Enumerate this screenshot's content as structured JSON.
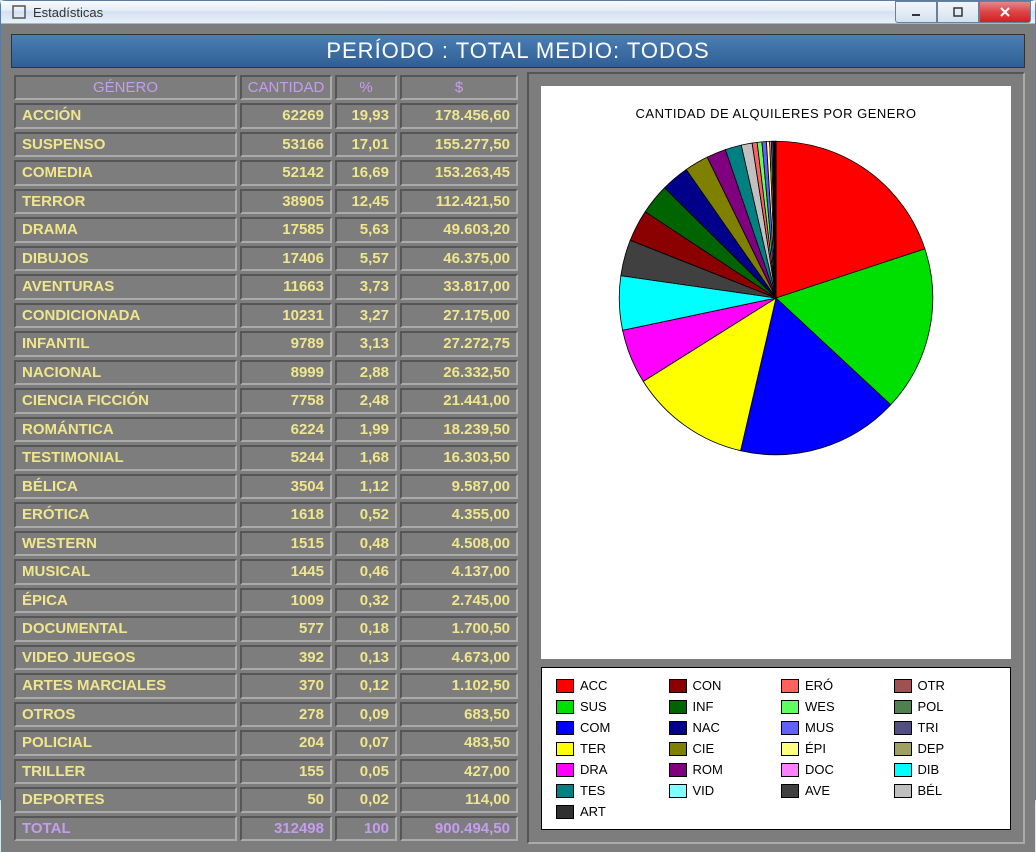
{
  "window": {
    "title": "Estadísticas"
  },
  "period_bar": "PERÍODO : TOTAL  MEDIO: TODOS",
  "table": {
    "headers": {
      "genero": "GÉNERO",
      "cantidad": "CANTIDAD",
      "pct": "%",
      "money": "$"
    },
    "rows": [
      {
        "genero": "ACCIÓN",
        "cantidad": "62269",
        "pct": "19,93",
        "money": "178.456,60"
      },
      {
        "genero": "SUSPENSO",
        "cantidad": "53166",
        "pct": "17,01",
        "money": "155.277,50"
      },
      {
        "genero": "COMEDIA",
        "cantidad": "52142",
        "pct": "16,69",
        "money": "153.263,45"
      },
      {
        "genero": "TERROR",
        "cantidad": "38905",
        "pct": "12,45",
        "money": "112.421,50"
      },
      {
        "genero": "DRAMA",
        "cantidad": "17585",
        "pct": "5,63",
        "money": "49.603,20"
      },
      {
        "genero": "DIBUJOS",
        "cantidad": "17406",
        "pct": "5,57",
        "money": "46.375,00"
      },
      {
        "genero": "AVENTURAS",
        "cantidad": "11663",
        "pct": "3,73",
        "money": "33.817,00"
      },
      {
        "genero": "CONDICIONADA",
        "cantidad": "10231",
        "pct": "3,27",
        "money": "27.175,00"
      },
      {
        "genero": "INFANTIL",
        "cantidad": "9789",
        "pct": "3,13",
        "money": "27.272,75"
      },
      {
        "genero": "NACIONAL",
        "cantidad": "8999",
        "pct": "2,88",
        "money": "26.332,50"
      },
      {
        "genero": "CIENCIA FICCIÓN",
        "cantidad": "7758",
        "pct": "2,48",
        "money": "21.441,00"
      },
      {
        "genero": "ROMÁNTICA",
        "cantidad": "6224",
        "pct": "1,99",
        "money": "18.239,50"
      },
      {
        "genero": "TESTIMONIAL",
        "cantidad": "5244",
        "pct": "1,68",
        "money": "16.303,50"
      },
      {
        "genero": "BÉLICA",
        "cantidad": "3504",
        "pct": "1,12",
        "money": "9.587,00"
      },
      {
        "genero": "ERÓTICA",
        "cantidad": "1618",
        "pct": "0,52",
        "money": "4.355,00"
      },
      {
        "genero": "WESTERN",
        "cantidad": "1515",
        "pct": "0,48",
        "money": "4.508,00"
      },
      {
        "genero": "MUSICAL",
        "cantidad": "1445",
        "pct": "0,46",
        "money": "4.137,00"
      },
      {
        "genero": "ÉPICA",
        "cantidad": "1009",
        "pct": "0,32",
        "money": "2.745,00"
      },
      {
        "genero": "DOCUMENTAL",
        "cantidad": "577",
        "pct": "0,18",
        "money": "1.700,50"
      },
      {
        "genero": "VIDEO JUEGOS",
        "cantidad": "392",
        "pct": "0,13",
        "money": "4.673,00"
      },
      {
        "genero": "ARTES MARCIALES",
        "cantidad": "370",
        "pct": "0,12",
        "money": "1.102,50"
      },
      {
        "genero": "OTROS",
        "cantidad": "278",
        "pct": "0,09",
        "money": "683,50"
      },
      {
        "genero": "POLICIAL",
        "cantidad": "204",
        "pct": "0,07",
        "money": "483,50"
      },
      {
        "genero": "TRILLER",
        "cantidad": "155",
        "pct": "0,05",
        "money": "427,00"
      },
      {
        "genero": "DEPORTES",
        "cantidad": "50",
        "pct": "0,02",
        "money": "114,00"
      }
    ],
    "total": {
      "genero": "TOTAL",
      "cantidad": "312498",
      "pct": "100",
      "money": "900.494,50"
    }
  },
  "chart_data": {
    "type": "pie",
    "title": "CANTIDAD DE ALQUILERES POR GENERO",
    "series": [
      {
        "name": "ACC",
        "value": 62269,
        "color": "#ff0000"
      },
      {
        "name": "SUS",
        "value": 53166,
        "color": "#00e000"
      },
      {
        "name": "COM",
        "value": 52142,
        "color": "#0000ff"
      },
      {
        "name": "TER",
        "value": 38905,
        "color": "#ffff00"
      },
      {
        "name": "DRA",
        "value": 17585,
        "color": "#ff00ff"
      },
      {
        "name": "DIB",
        "value": 17406,
        "color": "#00ffff"
      },
      {
        "name": "AVE",
        "value": 11663,
        "color": "#404040"
      },
      {
        "name": "CON",
        "value": 10231,
        "color": "#8b0000"
      },
      {
        "name": "INF",
        "value": 9789,
        "color": "#006400"
      },
      {
        "name": "NAC",
        "value": 8999,
        "color": "#00008b"
      },
      {
        "name": "CIE",
        "value": 7758,
        "color": "#808000"
      },
      {
        "name": "ROM",
        "value": 6224,
        "color": "#800080"
      },
      {
        "name": "TES",
        "value": 5244,
        "color": "#008080"
      },
      {
        "name": "BÉL",
        "value": 3504,
        "color": "#c0c0c0"
      },
      {
        "name": "ERÓ",
        "value": 1618,
        "color": "#ff6060"
      },
      {
        "name": "WES",
        "value": 1515,
        "color": "#60ff60"
      },
      {
        "name": "MUS",
        "value": 1445,
        "color": "#6060ff"
      },
      {
        "name": "ÉPI",
        "value": 1009,
        "color": "#ffff80"
      },
      {
        "name": "DOC",
        "value": 577,
        "color": "#ff80ff"
      },
      {
        "name": "VID",
        "value": 392,
        "color": "#80ffff"
      },
      {
        "name": "ART",
        "value": 370,
        "color": "#303030"
      },
      {
        "name": "OTR",
        "value": 278,
        "color": "#a05050"
      },
      {
        "name": "POL",
        "value": 204,
        "color": "#508050"
      },
      {
        "name": "TRI",
        "value": 155,
        "color": "#505080"
      },
      {
        "name": "DEP",
        "value": 50,
        "color": "#a0a060"
      }
    ]
  },
  "legend_order": [
    "ACC",
    "CON",
    "ERÓ",
    "OTR",
    "SUS",
    "INF",
    "WES",
    "POL",
    "COM",
    "NAC",
    "MUS",
    "TRI",
    "TER",
    "CIE",
    "ÉPI",
    "DEP",
    "DRA",
    "ROM",
    "DOC",
    "DIB",
    "TES",
    "VID",
    "AVE",
    "BÉL",
    "ART"
  ]
}
